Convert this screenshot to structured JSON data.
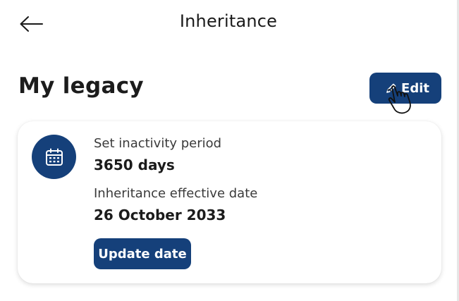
{
  "header": {
    "title": "Inheritance",
    "back_icon": "arrow-left-icon"
  },
  "section": {
    "title": "My legacy",
    "edit_label": "Edit",
    "edit_icon": "pencil-icon"
  },
  "card": {
    "icon": "calendar-icon",
    "inactivity_label": "Set inactivity period",
    "inactivity_value": "3650 days",
    "effective_label": "Inheritance effective date",
    "effective_value": "26 October 2033",
    "update_label": "Update date"
  },
  "colors": {
    "primary": "#15407a",
    "background": "#ffffff",
    "text": "#1b1b1b"
  }
}
